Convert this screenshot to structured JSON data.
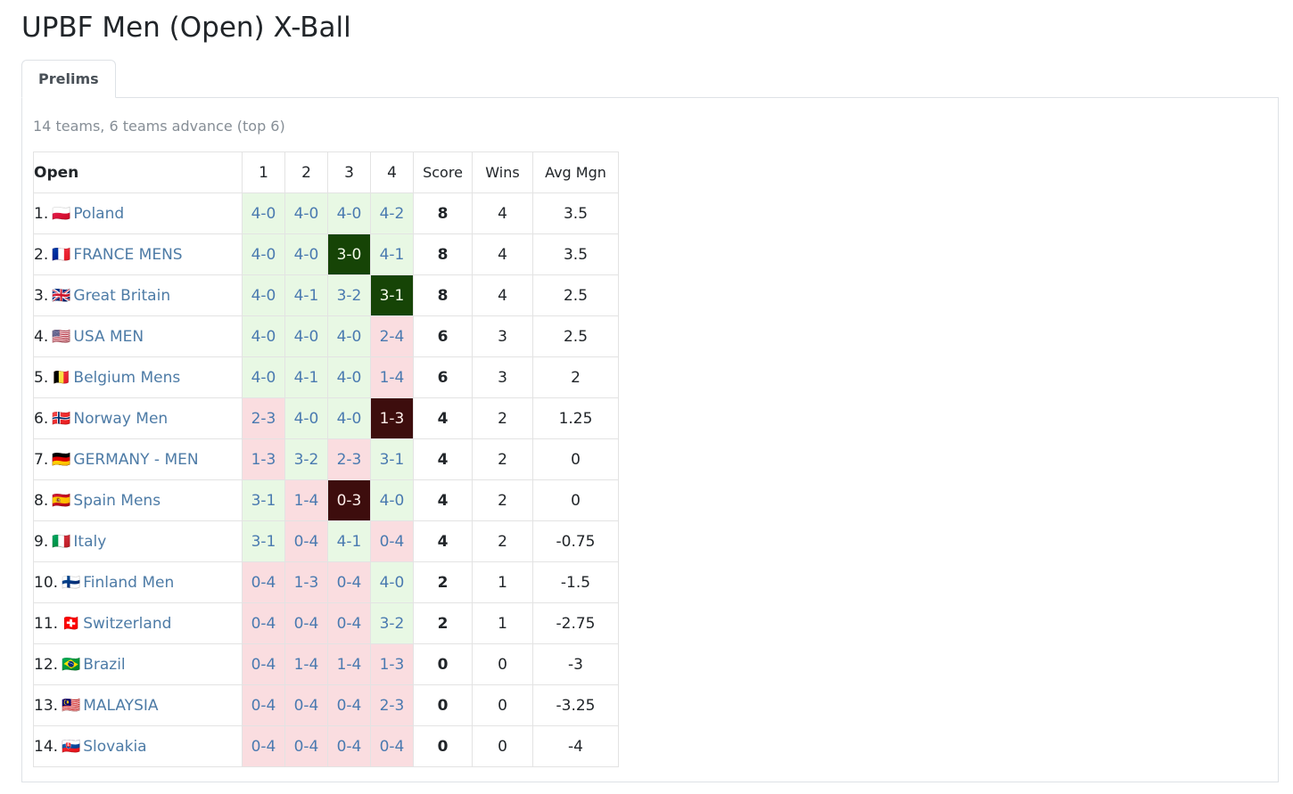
{
  "header": {
    "title": "UPBF Men (Open) X-Ball"
  },
  "tabs": [
    {
      "label": "Prelims",
      "active": true
    }
  ],
  "panel": {
    "caption": "14 teams, 6 teams advance (top 6)"
  },
  "table": {
    "columns": {
      "team": "Open",
      "r1": "1",
      "r2": "2",
      "r3": "3",
      "r4": "4",
      "score": "Score",
      "wins": "Wins",
      "avg": "Avg Mgn"
    },
    "colors": {
      "win_bg": "#e8f8e4",
      "loss_bg": "#fadde0",
      "bigwin_bg": "#164406",
      "bigloss_bg": "#3d0d0d",
      "result_text": "#4a7ab0",
      "team_link": "#4d7ba6"
    },
    "rows": [
      {
        "rank": "1.",
        "flag": "🇵🇱",
        "team": "Poland",
        "results": [
          {
            "value": "4-0",
            "state": "win"
          },
          {
            "value": "4-0",
            "state": "win"
          },
          {
            "value": "4-0",
            "state": "win"
          },
          {
            "value": "4-2",
            "state": "win"
          }
        ],
        "score": "8",
        "wins": "4",
        "avg": "3.5"
      },
      {
        "rank": "2.",
        "flag": "🇫🇷",
        "team": "FRANCE MENS",
        "results": [
          {
            "value": "4-0",
            "state": "win"
          },
          {
            "value": "4-0",
            "state": "win"
          },
          {
            "value": "3-0",
            "state": "bigwin"
          },
          {
            "value": "4-1",
            "state": "win"
          }
        ],
        "score": "8",
        "wins": "4",
        "avg": "3.5"
      },
      {
        "rank": "3.",
        "flag": "🇬🇧",
        "team": "Great Britain",
        "results": [
          {
            "value": "4-0",
            "state": "win"
          },
          {
            "value": "4-1",
            "state": "win"
          },
          {
            "value": "3-2",
            "state": "win"
          },
          {
            "value": "3-1",
            "state": "bigwin"
          }
        ],
        "score": "8",
        "wins": "4",
        "avg": "2.5"
      },
      {
        "rank": "4.",
        "flag": "🇺🇸",
        "team": "USA MEN",
        "results": [
          {
            "value": "4-0",
            "state": "win"
          },
          {
            "value": "4-0",
            "state": "win"
          },
          {
            "value": "4-0",
            "state": "win"
          },
          {
            "value": "2-4",
            "state": "loss"
          }
        ],
        "score": "6",
        "wins": "3",
        "avg": "2.5"
      },
      {
        "rank": "5.",
        "flag": "🇧🇪",
        "team": "Belgium Mens",
        "results": [
          {
            "value": "4-0",
            "state": "win"
          },
          {
            "value": "4-1",
            "state": "win"
          },
          {
            "value": "4-0",
            "state": "win"
          },
          {
            "value": "1-4",
            "state": "loss"
          }
        ],
        "score": "6",
        "wins": "3",
        "avg": "2"
      },
      {
        "rank": "6.",
        "flag": "🇳🇴",
        "team": "Norway Men",
        "results": [
          {
            "value": "2-3",
            "state": "loss"
          },
          {
            "value": "4-0",
            "state": "win"
          },
          {
            "value": "4-0",
            "state": "win"
          },
          {
            "value": "1-3",
            "state": "bigloss"
          }
        ],
        "score": "4",
        "wins": "2",
        "avg": "1.25"
      },
      {
        "rank": "7.",
        "flag": "🇩🇪",
        "team": "GERMANY - MEN",
        "results": [
          {
            "value": "1-3",
            "state": "loss"
          },
          {
            "value": "3-2",
            "state": "win"
          },
          {
            "value": "2-3",
            "state": "loss"
          },
          {
            "value": "3-1",
            "state": "win"
          }
        ],
        "score": "4",
        "wins": "2",
        "avg": "0"
      },
      {
        "rank": "8.",
        "flag": "🇪🇸",
        "team": "Spain Mens",
        "results": [
          {
            "value": "3-1",
            "state": "win"
          },
          {
            "value": "1-4",
            "state": "loss"
          },
          {
            "value": "0-3",
            "state": "bigloss"
          },
          {
            "value": "4-0",
            "state": "win"
          }
        ],
        "score": "4",
        "wins": "2",
        "avg": "0"
      },
      {
        "rank": "9.",
        "flag": "🇮🇹",
        "team": "Italy",
        "results": [
          {
            "value": "3-1",
            "state": "win"
          },
          {
            "value": "0-4",
            "state": "loss"
          },
          {
            "value": "4-1",
            "state": "win"
          },
          {
            "value": "0-4",
            "state": "loss"
          }
        ],
        "score": "4",
        "wins": "2",
        "avg": "-0.75"
      },
      {
        "rank": "10.",
        "flag": "🇫🇮",
        "team": "Finland Men",
        "results": [
          {
            "value": "0-4",
            "state": "loss"
          },
          {
            "value": "1-3",
            "state": "loss"
          },
          {
            "value": "0-4",
            "state": "loss"
          },
          {
            "value": "4-0",
            "state": "win"
          }
        ],
        "score": "2",
        "wins": "1",
        "avg": "-1.5"
      },
      {
        "rank": "11.",
        "flag": "🇨🇭",
        "team": "Switzerland",
        "results": [
          {
            "value": "0-4",
            "state": "loss"
          },
          {
            "value": "0-4",
            "state": "loss"
          },
          {
            "value": "0-4",
            "state": "loss"
          },
          {
            "value": "3-2",
            "state": "win"
          }
        ],
        "score": "2",
        "wins": "1",
        "avg": "-2.75"
      },
      {
        "rank": "12.",
        "flag": "🇧🇷",
        "team": "Brazil",
        "results": [
          {
            "value": "0-4",
            "state": "loss"
          },
          {
            "value": "1-4",
            "state": "loss"
          },
          {
            "value": "1-4",
            "state": "loss"
          },
          {
            "value": "1-3",
            "state": "loss"
          }
        ],
        "score": "0",
        "wins": "0",
        "avg": "-3"
      },
      {
        "rank": "13.",
        "flag": "🇲🇾",
        "team": "MALAYSIA",
        "results": [
          {
            "value": "0-4",
            "state": "loss"
          },
          {
            "value": "0-4",
            "state": "loss"
          },
          {
            "value": "0-4",
            "state": "loss"
          },
          {
            "value": "2-3",
            "state": "loss"
          }
        ],
        "score": "0",
        "wins": "0",
        "avg": "-3.25"
      },
      {
        "rank": "14.",
        "flag": "🇸🇰",
        "team": "Slovakia",
        "results": [
          {
            "value": "0-4",
            "state": "loss"
          },
          {
            "value": "0-4",
            "state": "loss"
          },
          {
            "value": "0-4",
            "state": "loss"
          },
          {
            "value": "0-4",
            "state": "loss"
          }
        ],
        "score": "0",
        "wins": "0",
        "avg": "-4"
      }
    ]
  }
}
